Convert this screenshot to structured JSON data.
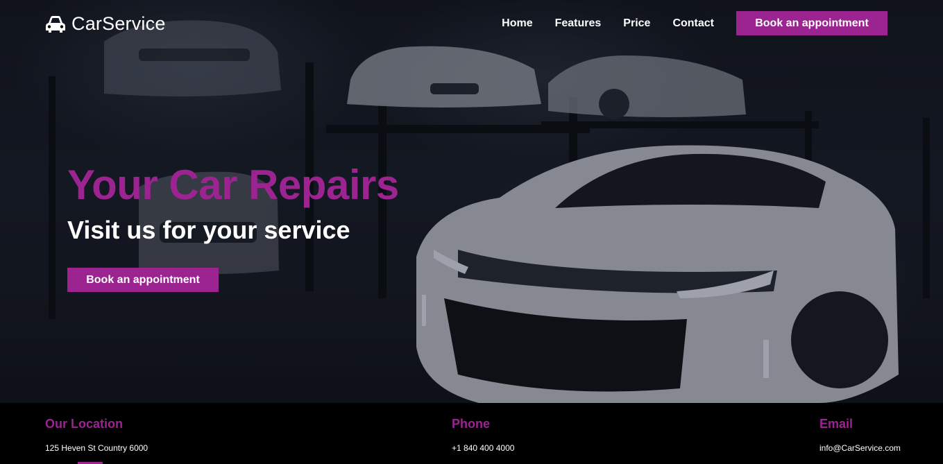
{
  "brand": {
    "name": "CarService",
    "icon": "car-icon"
  },
  "nav": {
    "links": [
      "Home",
      "Features",
      "Price",
      "Contact"
    ],
    "cta": "Book an appointment"
  },
  "hero": {
    "title": "Your Car Repairs",
    "subtitle": "Visit us for your service",
    "cta": "Book an appointment"
  },
  "info": {
    "location": {
      "heading": "Our Location",
      "value": "125 Heven St Country 6000"
    },
    "phone": {
      "heading": "Phone",
      "value": "+1 840 400 4000"
    },
    "email": {
      "heading": "Email",
      "value": "info@CarService.com"
    }
  },
  "colors": {
    "accent": "#9b2491",
    "background": "#000000",
    "text": "#ffffff"
  }
}
